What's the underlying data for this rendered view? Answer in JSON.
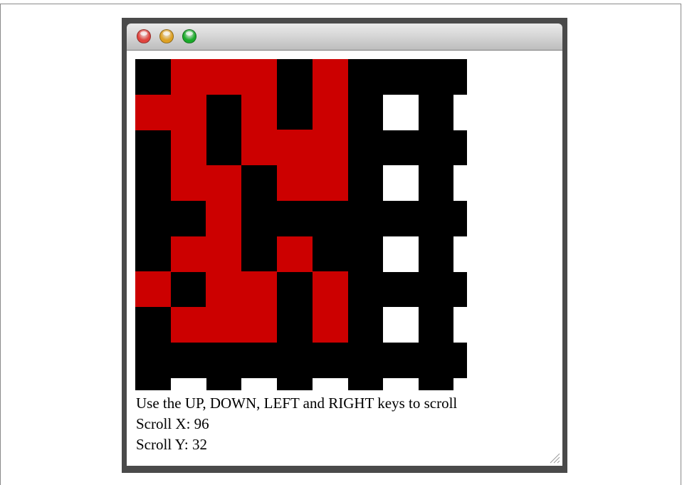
{
  "window": {
    "titlebar_lights": {
      "close": {
        "icon": "close-traffic-light-icon",
        "color": "#e0443e"
      },
      "minimize": {
        "icon": "minimize-traffic-light-icon",
        "color": "#dea123"
      },
      "zoom": {
        "icon": "zoom-traffic-light-icon",
        "color": "#1aab29"
      }
    }
  },
  "grid": {
    "rows": 9,
    "cols": 10,
    "colors": {
      "K": "#000000",
      "R": "#cc0000",
      "W": "#ffffff"
    },
    "cells": [
      "KRRRKRKKKK",
      "RRKRKRKWKW",
      "KRKRRRKKKK",
      "KRRKRRKWKW",
      "KKRKKKKKKK",
      "KRRKRKKWKW",
      "RKRRKRKKKK",
      "KRRRKRKWKW",
      "KKKKKKKKKK"
    ],
    "bottom_notches": 5
  },
  "instructions": "Use the UP, DOWN, LEFT and RIGHT keys to scroll",
  "scroll": {
    "x_text": "Scroll X: 96",
    "y_text": "Scroll Y: 32"
  }
}
